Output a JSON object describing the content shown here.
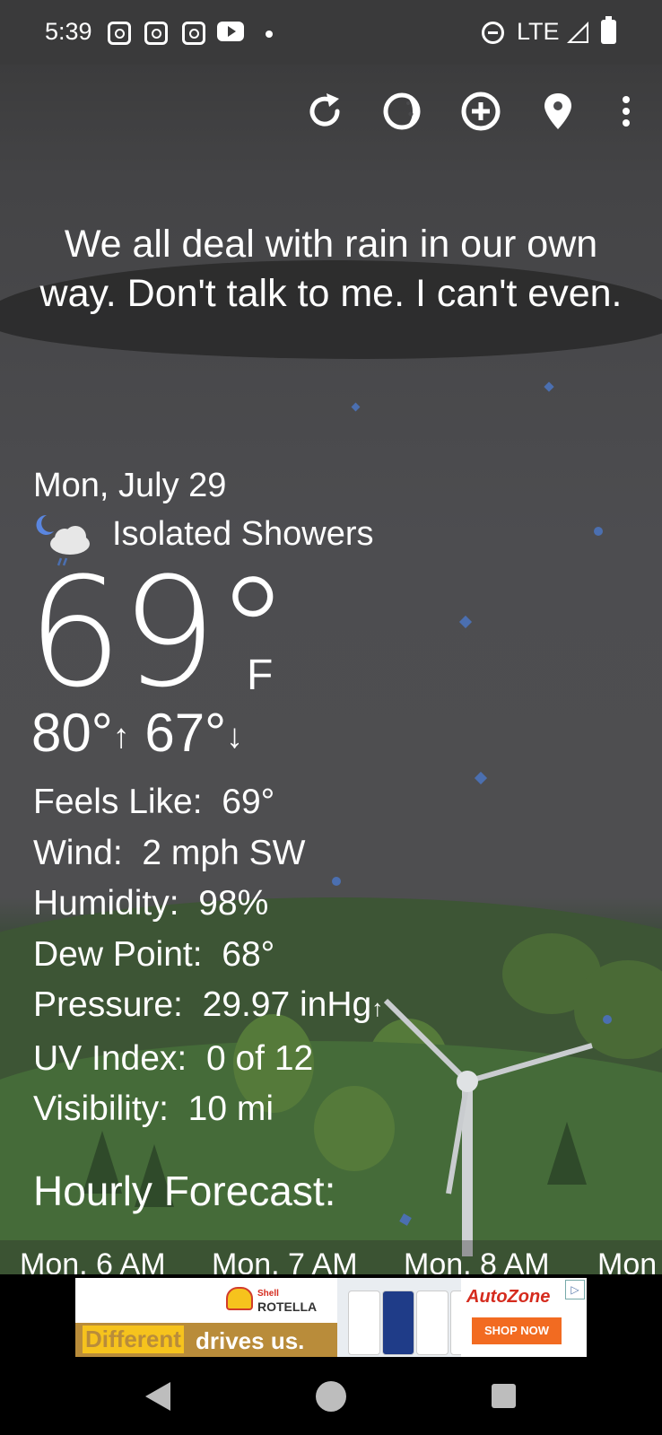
{
  "status_bar": {
    "time": "5:39",
    "notification_icons": [
      "instagram-icon",
      "instagram-icon",
      "instagram-icon",
      "youtube-icon",
      "dot"
    ],
    "network": "LTE",
    "right_icons": [
      "do-not-disturb-icon",
      "signal-icon",
      "battery-icon"
    ]
  },
  "toolbar": {
    "icons": [
      "refresh-icon",
      "moon-phase-icon",
      "add-icon",
      "location-icon",
      "more-icon"
    ]
  },
  "quote": "We all deal with rain in our own way. Don't talk to me. I can't even.",
  "weather": {
    "date": "Mon, July 29",
    "condition": "Isolated Showers",
    "condition_icon": "night-showers-icon",
    "temperature": "69°",
    "unit": "F",
    "high": "80°",
    "low": "67°",
    "details": [
      {
        "label": "Feels Like:",
        "value": "69°"
      },
      {
        "label": "Wind:",
        "value": "2 mph SW"
      },
      {
        "label": "Humidity:",
        "value": "98%"
      },
      {
        "label": "Dew Point:",
        "value": "68°"
      },
      {
        "label": "Pressure:",
        "value": "29.97 inHg"
      },
      {
        "label": "UV Index:",
        "value": "0 of 12"
      },
      {
        "label": "Visibility:",
        "value": "10 mi"
      }
    ]
  },
  "hourly": {
    "title": "Hourly Forecast:",
    "items": [
      "Mon, 6 AM",
      "Mon, 7 AM",
      "Mon, 8 AM",
      "Mon"
    ]
  },
  "ad": {
    "brand_line1": "Shell",
    "brand_line2": "ROTELLA",
    "slogan_highlight": "Different",
    "slogan_rest": "drives us.",
    "retailer": "AutoZone",
    "cta": "SHOP NOW"
  },
  "colors": {
    "accent_drop": "#4b6fb0",
    "status_bar": "#3a3a3b"
  }
}
